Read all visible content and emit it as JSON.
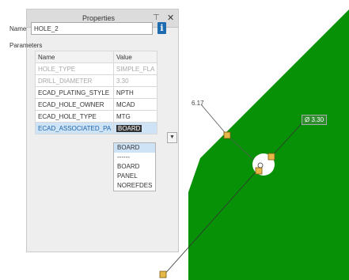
{
  "panel": {
    "title": "Properties",
    "name_label": "Name",
    "name_value": "HOLE_2",
    "parameters_label": "Parameters",
    "columns": [
      "Name",
      "Value"
    ],
    "rows": [
      {
        "name": "HOLE_TYPE",
        "value": "SIMPLE_FLA"
      },
      {
        "name": "DRILL_DIAMETER",
        "value": "3.30"
      },
      {
        "name": "ECAD_PLATING_STYLE",
        "value": "NPTH"
      },
      {
        "name": "ECAD_HOLE_OWNER",
        "value": "MCAD"
      },
      {
        "name": "ECAD_HOLE_TYPE",
        "value": "MTG"
      },
      {
        "name": "ECAD_ASSOCIATED_PA",
        "value": "BOARD"
      }
    ],
    "dropdown_options": [
      "BOARD",
      "------",
      "BOARD",
      "PANEL",
      "NOREFDES"
    ]
  },
  "canvas": {
    "dimension_label": "6.17",
    "diameter_label": "Ø 3.30",
    "board_color": "#079107"
  }
}
